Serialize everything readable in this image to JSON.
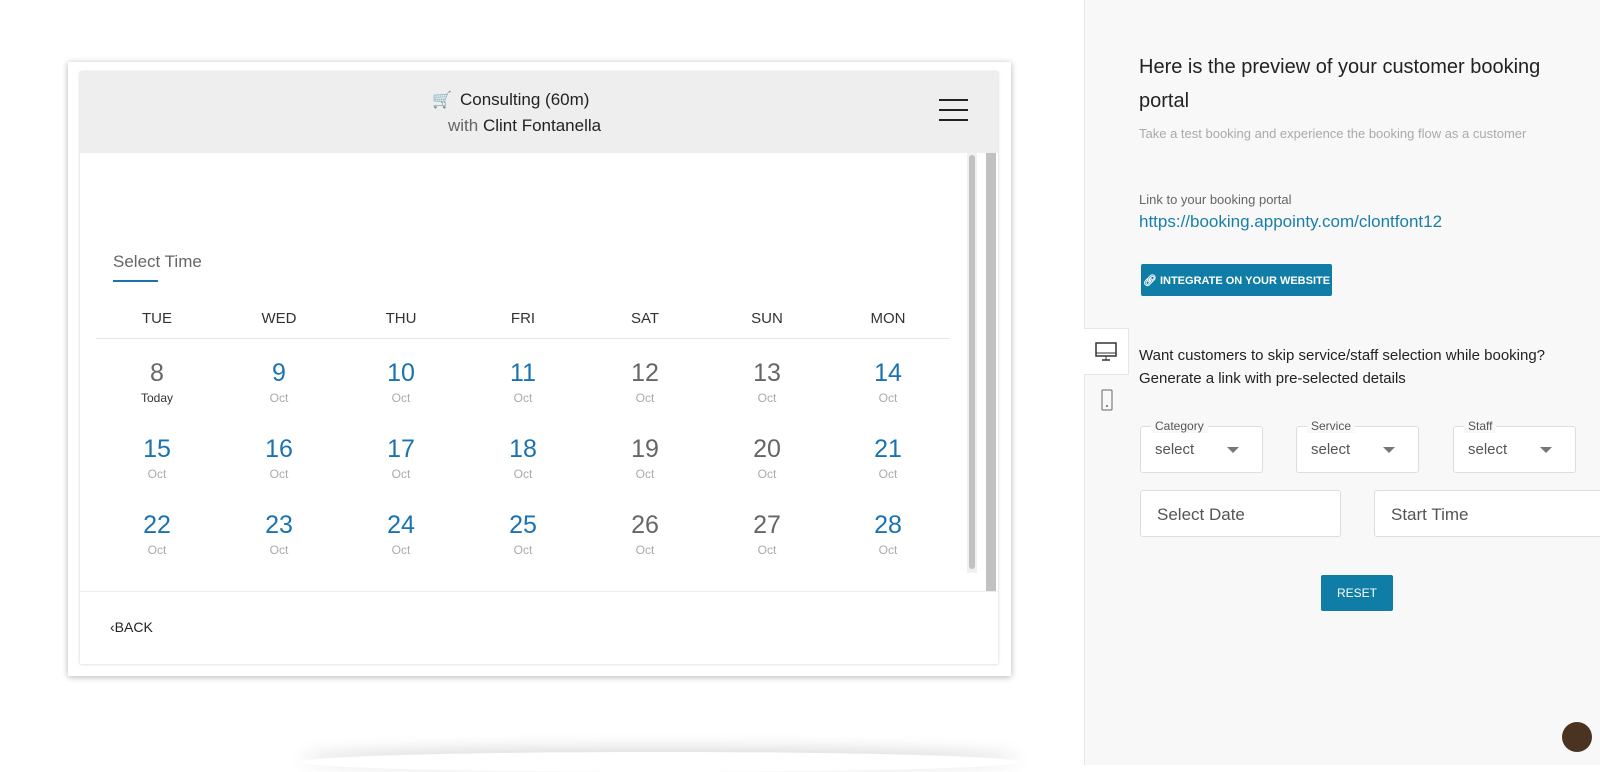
{
  "preview": {
    "service_title": "Consulting (60m)",
    "with_label": "with",
    "staff_name": "Clint Fontanella",
    "select_time": "Select Time",
    "weekdays": [
      "TUE",
      "WED",
      "THU",
      "FRI",
      "SAT",
      "SUN",
      "MON"
    ],
    "weeks": [
      [
        {
          "n": "8",
          "m": "Today",
          "s": "g t"
        },
        {
          "n": "9",
          "m": "Oct",
          "s": ""
        },
        {
          "n": "10",
          "m": "Oct",
          "s": ""
        },
        {
          "n": "11",
          "m": "Oct",
          "s": ""
        },
        {
          "n": "12",
          "m": "Oct",
          "s": "g"
        },
        {
          "n": "13",
          "m": "Oct",
          "s": "g"
        },
        {
          "n": "14",
          "m": "Oct",
          "s": ""
        }
      ],
      [
        {
          "n": "15",
          "m": "Oct",
          "s": ""
        },
        {
          "n": "16",
          "m": "Oct",
          "s": ""
        },
        {
          "n": "17",
          "m": "Oct",
          "s": ""
        },
        {
          "n": "18",
          "m": "Oct",
          "s": ""
        },
        {
          "n": "19",
          "m": "Oct",
          "s": "g"
        },
        {
          "n": "20",
          "m": "Oct",
          "s": "g"
        },
        {
          "n": "21",
          "m": "Oct",
          "s": ""
        }
      ],
      [
        {
          "n": "22",
          "m": "Oct",
          "s": ""
        },
        {
          "n": "23",
          "m": "Oct",
          "s": ""
        },
        {
          "n": "24",
          "m": "Oct",
          "s": ""
        },
        {
          "n": "25",
          "m": "Oct",
          "s": ""
        },
        {
          "n": "26",
          "m": "Oct",
          "s": "g"
        },
        {
          "n": "27",
          "m": "Oct",
          "s": "g"
        },
        {
          "n": "28",
          "m": "Oct",
          "s": ""
        }
      ]
    ],
    "back_label": "BACK"
  },
  "panel": {
    "title": "Here is the preview of your customer booking portal",
    "subtitle": "Take a test booking and experience the booking flow as a customer",
    "link_label": "Link to your booking portal",
    "link": "https://booking.appointy.com/clontfont12",
    "integrate_label": "INTEGRATE ON YOUR WEBSITE",
    "question": "Want customers to skip service/staff selection while booking?",
    "question2": "Generate a link with pre-selected details",
    "dropdowns": [
      {
        "label": "Category",
        "value": "select"
      },
      {
        "label": "Service",
        "value": "select"
      },
      {
        "label": "Staff",
        "value": "select"
      }
    ],
    "date_placeholder": "Select Date",
    "time_placeholder": "Start Time",
    "reset_label": "RESET"
  },
  "colors": {
    "accent": "#0f7da6",
    "date_blue": "#1a73b0"
  }
}
